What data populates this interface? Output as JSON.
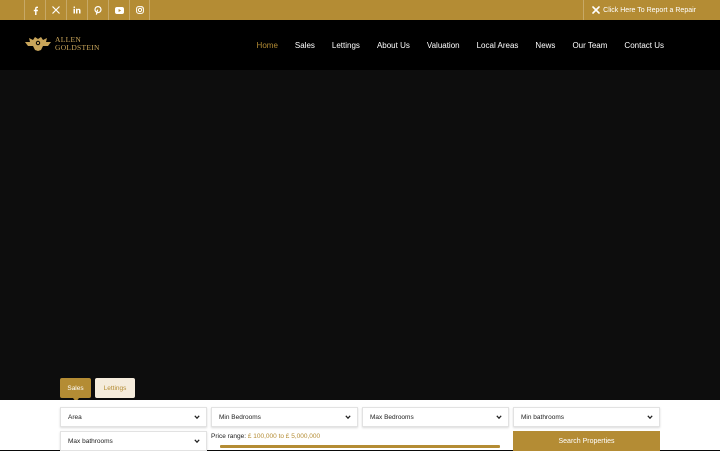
{
  "topbar": {
    "socials": [
      "facebook-icon",
      "x-icon",
      "linkedin-icon",
      "pinterest-icon",
      "youtube-icon",
      "instagram-icon"
    ],
    "repair_label": "Click Here To Report a Repair"
  },
  "header": {
    "logo_line1": "ALLEN",
    "logo_line2": "GOLDSTEIN",
    "nav": [
      "Home",
      "Sales",
      "Lettings",
      "About Us",
      "Valuation",
      "Local Areas",
      "News",
      "Our Team",
      "Contact Us"
    ],
    "active_nav": "Home"
  },
  "search": {
    "tabs": {
      "sales": "Sales",
      "lettings": "Lettings"
    },
    "area": "Area",
    "min_bedrooms": "Min Bedrooms",
    "max_bedrooms": "Max Bedrooms",
    "min_bathrooms": "Min bathrooms",
    "max_bathrooms": "Max bathrooms",
    "price_label": "Price range:",
    "price_value": "£ 100,000 to £ 5,000,000",
    "button": "Search Properties"
  },
  "colors": {
    "accent": "#b48c34",
    "header_bg": "#000000",
    "hero_bg": "#0d0d0d"
  }
}
